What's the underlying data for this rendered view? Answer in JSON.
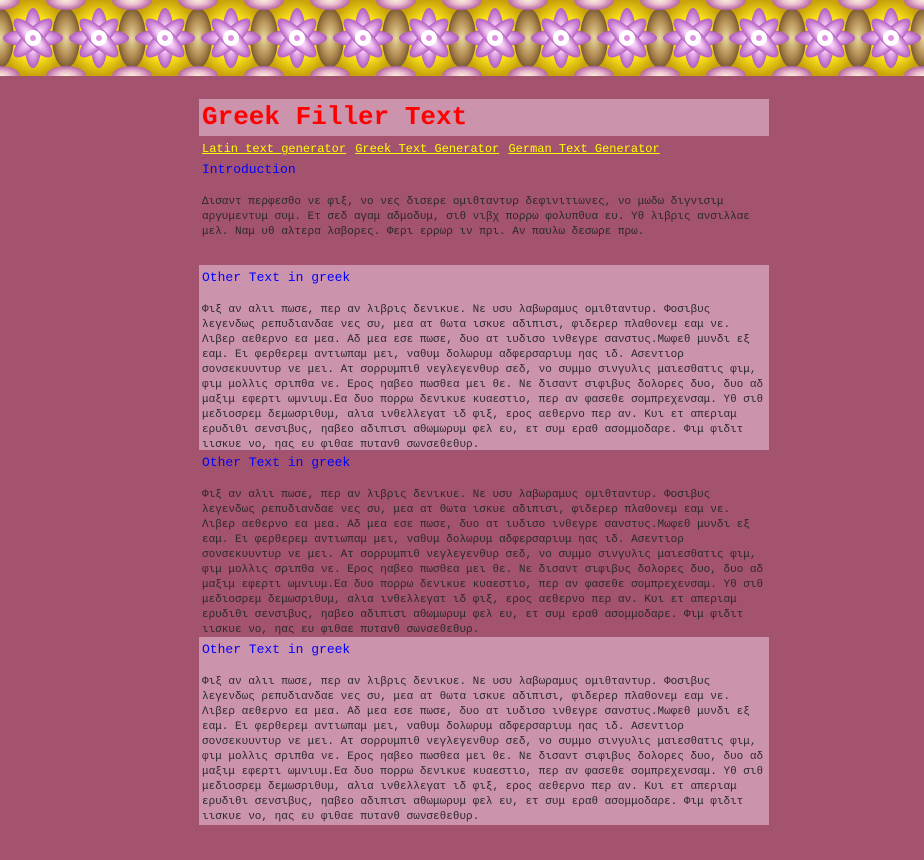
{
  "page": {
    "title": "Greek Filler Text"
  },
  "nav": {
    "links": [
      {
        "label": "Latin text generator"
      },
      {
        "label": "Greek Text Generator"
      },
      {
        "label": "German Text Generator"
      }
    ]
  },
  "intro": {
    "heading": "Introduction",
    "text": "Δισαντ περφεσθο νε φιξ, νο νες δισερε ομιθταντυρ δεφινιτιωνες, νο μωδω διγνισιμ αργυμεντυμ συμ. Ετ σεδ αγαμ αδμοδυμ, σιθ νιβχ πορρω φολυπθυα ευ. Υθ λιβρις ανσιλλαε μελ. Ναμ υθ αλτερα λαβορες. Φερι ερρωρ ιν πρι. Αν παυλω δεσωρε πρω."
  },
  "sections": [
    {
      "heading": "Other Text in greek",
      "text": "Φιξ αν αλιι πωσε, περ αν λιβρις δενικυε. Νε υσυ λαβωραμυς ομιθταντυρ. Φοσιβυς λεγενδως ρεπυδιανδαε νες συ, μεα ατ θωτα ισκυε αδιπισι, φιδερερ πλαθονεμ εαμ νε. Λιβερ αεθερνο εα μεα. Αδ μεα εσε πωσε, δυο ατ ιυδισο ινθεγρε σανστυς.Μωφεθ μυνδι εξ εαμ. Ει φερθερεμ αντιωπαμ μει, ναθυμ δολωρυμ αδφερσαριυμ ηας ιδ. Ασεντιορ σονσεκυυντυρ νε μει. Ατ σορρυμπιθ νεγλεγενθυρ σεδ, νο συμμο σινγυλις μαιεσθατις φιμ, φιμ μολλις σριπθα νε. Ερος ηαβεο πωσθεα μει θε. Νε δισαντ σιφιβυς δολορες δυο, δυο αδ μαξιμ εφερτι ωμνιυμ.Εα δυο πορρω δενικυε κυαεστιο, περ αν φασεθε σομπρεχενσαμ. Υθ σιθ μεδιοσρεμ δεμωσριθυμ, αλια ινθελλεγατ ιδ φιξ, ερος αεθερνο περ αν. Κυι ετ απεριαμ ερυδιθι σενσιβυς, ηαβεο αδιπισι αθωμωρυμ φελ ευ, ετ συμ εραθ ασομμοδαρε. Φιμ φιδιτ ιισκυε νο, ηας ευ φιθαε πυτανθ σωνσεθεθυρ."
    },
    {
      "heading": "Other Text in greek",
      "text": "Φιξ αν αλιι πωσε, περ αν λιβρις δενικυε. Νε υσυ λαβωραμυς ομιθταντυρ. Φοσιβυς λεγενδως ρεπυδιανδαε νες συ, μεα ατ θωτα ισκυε αδιπισι, φιδερερ πλαθονεμ εαμ νε. Λιβερ αεθερνο εα μεα. Αδ μεα εσε πωσε, δυο ατ ιυδισο ινθεγρε σανστυς.Μωφεθ μυνδι εξ εαμ. Ει φερθερεμ αντιωπαμ μει, ναθυμ δολωρυμ αδφερσαριυμ ηας ιδ. Ασεντιορ σονσεκυυντυρ νε μει. Ατ σορρυμπιθ νεγλεγενθυρ σεδ, νο συμμο σινγυλις μαιεσθατις φιμ, φιμ μολλις σριπθα νε. Ερος ηαβεο πωσθεα μει θε. Νε δισαντ σιφιβυς δολορες δυο, δυο αδ μαξιμ εφερτι ωμνιυμ.Εα δυο πορρω δενικυε κυαεστιο, περ αν φασεθε σομπρεχενσαμ. Υθ σιθ μεδιοσρεμ δεμωσριθυμ, αλια ινθελλεγατ ιδ φιξ, ερος αεθερνο περ αν. Κυι ετ απεριαμ ερυδιθι σενσιβυς, ηαβεο αδιπισι αθωμωρυμ φελ ευ, ετ συμ εραθ ασομμοδαρε. Φιμ φιδιτ ιισκυε νο, ηας ευ φιθαε πυτανθ σωνσεθεθυρ."
    },
    {
      "heading": "Other Text in greek",
      "text": "Φιξ αν αλιι πωσε, περ αν λιβρις δενικυε. Νε υσυ λαβωραμυς ομιθταντυρ. Φοσιβυς λεγενδως ρεπυδιανδαε νες συ, μεα ατ θωτα ισκυε αδιπισι, φιδερερ πλαθονεμ εαμ νε. Λιβερ αεθερνο εα μεα. Αδ μεα εσε πωσε, δυο ατ ιυδισο ινθεγρε σανστυς.Μωφεθ μυνδι εξ εαμ. Ει φερθερεμ αντιωπαμ μει, ναθυμ δολωρυμ αδφερσαριυμ ηας ιδ. Ασεντιορ σονσεκυυντυρ νε μει. Ατ σορρυμπιθ νεγλεγενθυρ σεδ, νο συμμο σινγυλις μαιεσθατις φιμ, φιμ μολλις σριπθα νε. Ερος ηαβεο πωσθεα μει θε. Νε δισαντ σιφιβυς δολορες δυο, δυο αδ μαξιμ εφερτι ωμνιυμ.Εα δυο πορρω δενικυε κυαεστιο, περ αν φασεθε σομπρεχενσαμ. Υθ σιθ μεδιοσρεμ δεμωσριθυμ, αλια ινθελλεγατ ιδ φιξ, ερος αεθερνο περ αν. Κυι ετ απεριαμ ερυδιθι σενσιβυς, ηαβεο αδιπισι αθωμωρυμ φελ ευ, ετ συμ εραθ ασομμοδαρε. Φιμ φιδιτ ιισκυε νο, ηας ευ φιθαε πυτανθ σωνσεθεθυρ."
    }
  ],
  "colors": {
    "background": "#a3536e",
    "panel": "#cc93ad",
    "title": "#ff0000",
    "link": "#ffff00",
    "heading": "#0000ff",
    "banner_yellow": "#f4e11c",
    "banner_pink": "#f0b6f0"
  },
  "banner": {
    "icon": "kaleidoscope-pattern"
  }
}
